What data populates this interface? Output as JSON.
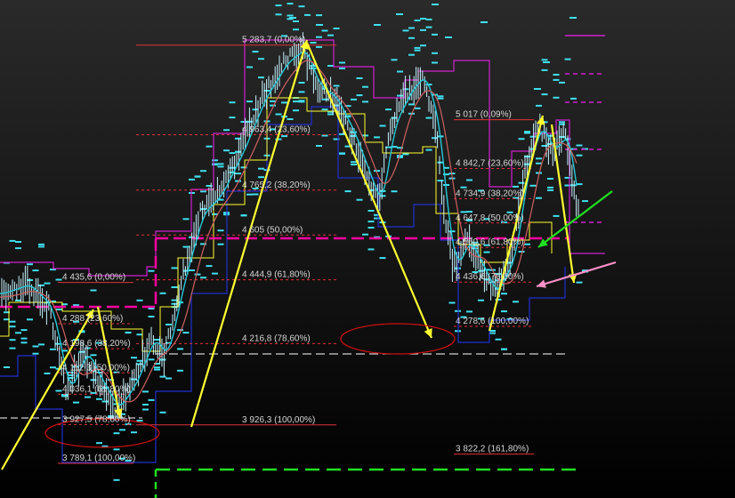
{
  "colors": {
    "background_top": "#2a2a2a",
    "background_bottom": "#000000",
    "fib_line": "#e0303a",
    "label": "#d6d6d6",
    "cyan_dash": "#3fe0f0",
    "price_bar": "#c8f4ff",
    "ma_cyan": "#25c9d8",
    "ma_red": "#d06060",
    "magenta": "#d020d0",
    "yellow": "#ffff30",
    "blue": "#2030d0",
    "green": "#20e020",
    "pink": "#ff90c8",
    "white": "#ffffff"
  },
  "chart_data": {
    "type": "line",
    "ylim": [
      3700,
      5400
    ],
    "x": [
      0,
      100
    ],
    "fib_sets": [
      {
        "name": "left",
        "levels": [
          {
            "value": 4435.6,
            "label": "4 435,6 (0,00%)"
          },
          {
            "value": 4288,
            "label": "4 288 (23,60%)"
          },
          {
            "value": 4198.6,
            "label": "4 198,6 (38,20%)"
          },
          {
            "value": 4112.3,
            "label": "4 112,3 (50,00%)"
          },
          {
            "value": 4036.1,
            "label": "4 036,1 (61,80%)"
          },
          {
            "value": 3927.5,
            "label": "3 927,5 (78,60%)"
          },
          {
            "value": 3789.1,
            "label": "3 789,1 (100,00%)"
          }
        ]
      },
      {
        "name": "middle",
        "levels": [
          {
            "value": 5283.7,
            "label": "5 283,7 (0,00%)"
          },
          {
            "value": 4963.4,
            "label": "4 963,4 (23,60%)"
          },
          {
            "value": 4765.2,
            "label": "4 765,2 (38,20%)"
          },
          {
            "value": 4605,
            "label": "4 605 (50,00%)"
          },
          {
            "value": 4444.9,
            "label": "4 444,9 (61,80%)"
          },
          {
            "value": 4216.8,
            "label": "4 216,8 (78,60%)"
          },
          {
            "value": 3926.3,
            "label": "3 926,3 (100,00%)"
          }
        ]
      },
      {
        "name": "right",
        "levels": [
          {
            "value": 5017,
            "label": "5 017 (0,09%)"
          },
          {
            "value": 4842.7,
            "label": "4 842,7 (23,60%)"
          },
          {
            "value": 4734.9,
            "label": "4 734,9 (38,20%)"
          },
          {
            "value": 4647.8,
            "label": "4 647,8 (50,00%)"
          },
          {
            "value": 4560.6,
            "label": "4 560,6 (61,80%)"
          },
          {
            "value": 4436.6,
            "label": "4 436,6 (78,60%)"
          },
          {
            "value": 4278.6,
            "label": "4 278,6 (100,00%)"
          },
          {
            "value": 3822.2,
            "label": "3 822,2 (161,80%)"
          }
        ]
      }
    ]
  }
}
